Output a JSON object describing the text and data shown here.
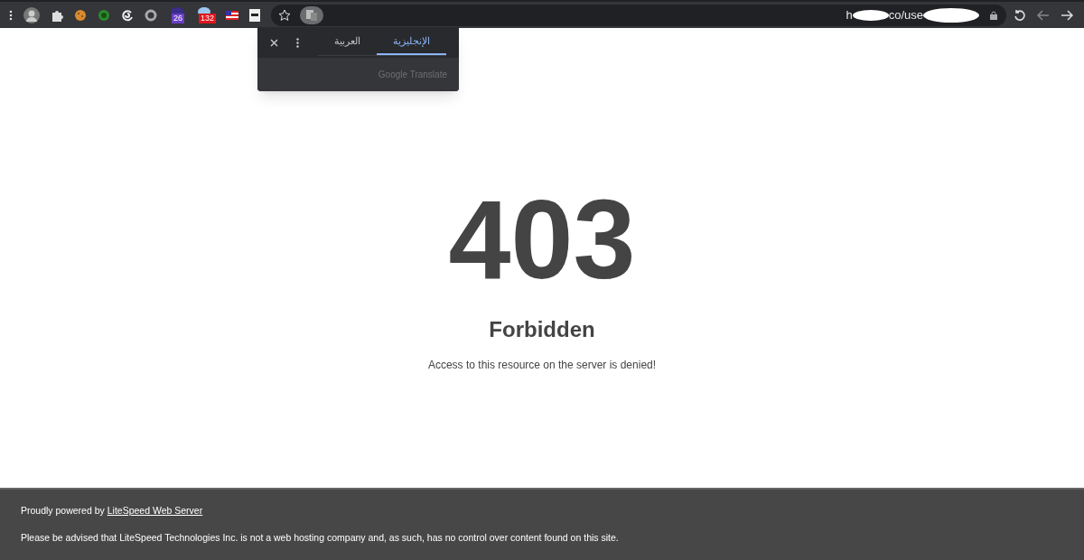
{
  "toolbar": {
    "extension_badges": [
      {
        "count": "26",
        "color": "#6a3fc8"
      },
      {
        "count": "132",
        "color": "#e0161c"
      }
    ],
    "address": {
      "start": "h",
      "middle": "co/use"
    }
  },
  "translate_popup": {
    "tabs": [
      {
        "label": "الإنجليزية",
        "selected": true
      },
      {
        "label": "العربية",
        "selected": false
      }
    ],
    "brand": "Google Translate"
  },
  "error": {
    "code": "403",
    "title": "Forbidden",
    "message": "Access to this resource on the server is denied!"
  },
  "footer": {
    "powered_by": "Proudly powered by",
    "link": "LiteSpeed Web Server",
    "notice": "Please be advised that LiteSpeed Technologies Inc. is not a web hosting company and, as such, has no control over content found on this site."
  }
}
